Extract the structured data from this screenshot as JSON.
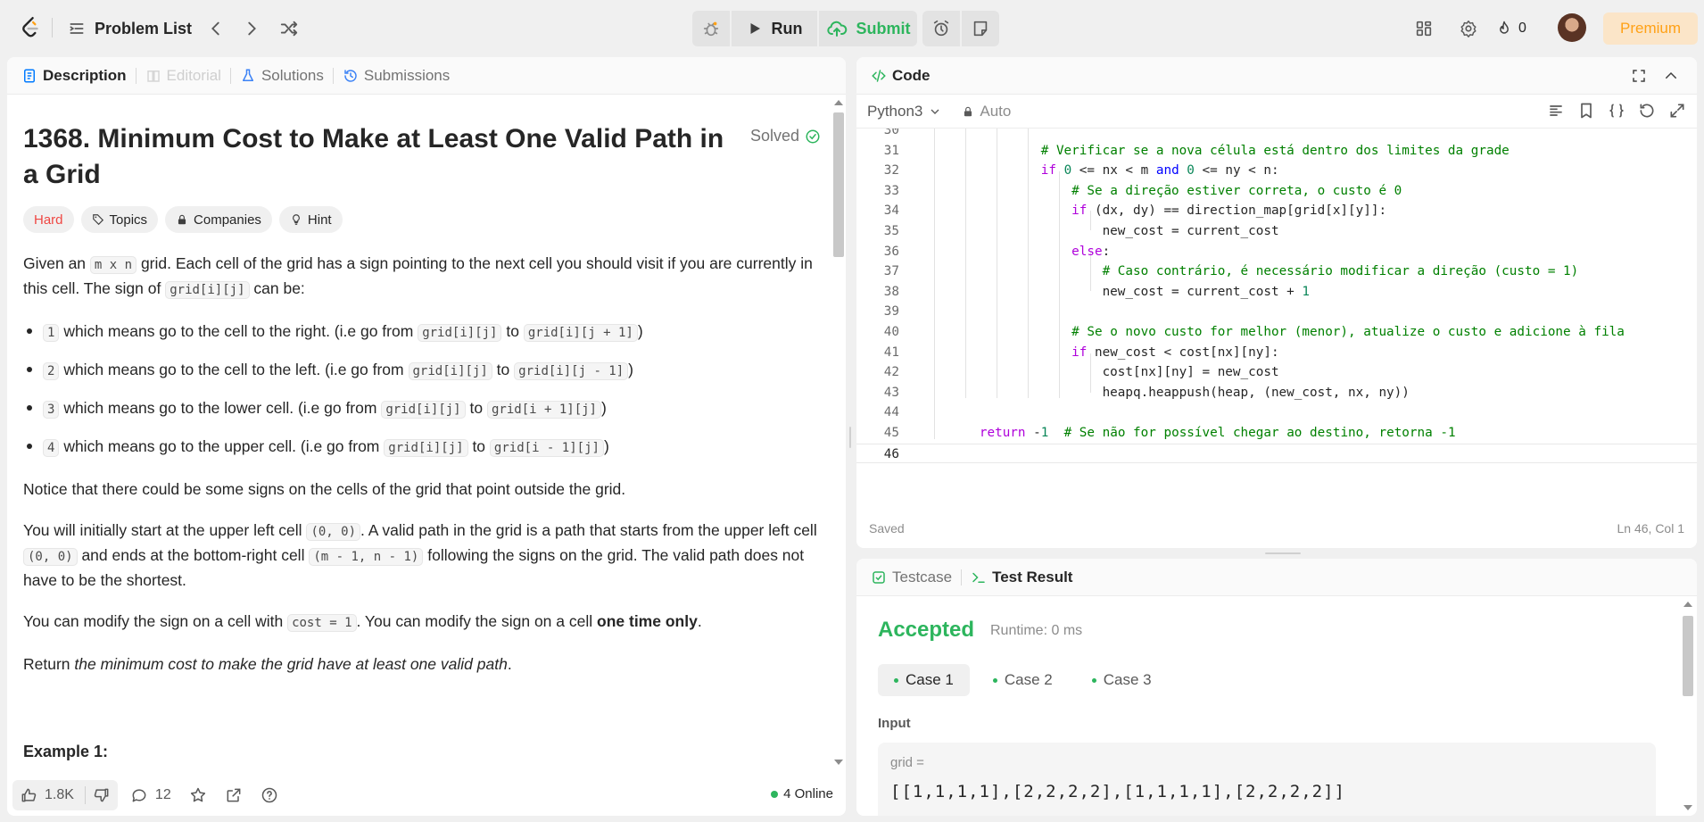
{
  "topbar": {
    "problem_list": "Problem List",
    "run": "Run",
    "submit": "Submit",
    "streak_count": "0",
    "premium": "Premium"
  },
  "description_tabs": [
    "Description",
    "Editorial",
    "Solutions",
    "Submissions"
  ],
  "problem": {
    "title": "1368. Minimum Cost to Make at Least One Valid Path in a Grid",
    "solved": "Solved",
    "difficulty": "Hard",
    "tags": [
      "Topics",
      "Companies",
      "Hint"
    ],
    "intro_1": "Given an",
    "intro_code_1": "m x n",
    "intro_2": "grid. Each cell of the grid has a sign pointing to the next cell you should visit if you are currently in this cell. The sign of",
    "intro_code_2": "grid[i][j]",
    "intro_3": "can be:",
    "signs": [
      {
        "value": "1",
        "text": "which means go to the cell to the right. (i.e go from",
        "from": "grid[i][j]",
        "to_word": "to",
        "to": "grid[i][j + 1]",
        "close": ")"
      },
      {
        "value": "2",
        "text": "which means go to the cell to the left. (i.e go from",
        "from": "grid[i][j]",
        "to_word": "to",
        "to": "grid[i][j - 1]",
        "close": ")"
      },
      {
        "value": "3",
        "text": "which means go to the lower cell. (i.e go from",
        "from": "grid[i][j]",
        "to_word": "to",
        "to": "grid[i + 1][j]",
        "close": ")"
      },
      {
        "value": "4",
        "text": "which means go to the upper cell. (i.e go from",
        "from": "grid[i][j]",
        "to_word": "to",
        "to": "grid[i - 1][j]",
        "close": ")"
      }
    ],
    "notice": "Notice that there could be some signs on the cells of the grid that point outside the grid.",
    "start_1": "You will initially start at the upper left cell",
    "start_code_1": "(0, 0)",
    "start_2": ". A valid path in the grid is a path that starts from the upper left cell",
    "start_code_2": "(0, 0)",
    "start_3": "and ends at the bottom-right cell",
    "start_code_3": "(m - 1, n - 1)",
    "start_4": "following the signs on the grid. The valid path does not have to be the shortest.",
    "modify_1": "You can modify the sign on a cell with",
    "modify_code": "cost = 1",
    "modify_2": ". You can modify the sign on a cell",
    "modify_bold": "one time only",
    "modify_3": ".",
    "return_1": "Return",
    "return_em": "the minimum cost to make the grid have at least one valid path",
    "return_2": ".",
    "example_title": "Example 1:"
  },
  "footer": {
    "likes": "1.8K",
    "comments": "12",
    "online": "4 Online"
  },
  "code": {
    "tab": "Code",
    "language": "Python3",
    "mode": "Auto",
    "saved": "Saved",
    "cursor": "Ln 46, Col 1"
  },
  "test": {
    "tabs": [
      "Testcase",
      "Test Result"
    ],
    "verdict": "Accepted",
    "runtime": "Runtime: 0 ms",
    "cases": [
      "Case 1",
      "Case 2",
      "Case 3"
    ],
    "input_label": "Input",
    "input_name": "grid =",
    "input_value": "[[1,1,1,1],[2,2,2,2],[1,1,1,1],[2,2,2,2]]"
  },
  "colors": {
    "accent_green": "#2db55d",
    "hard_red": "#ef4743",
    "premium_orange": "#ffa116"
  }
}
